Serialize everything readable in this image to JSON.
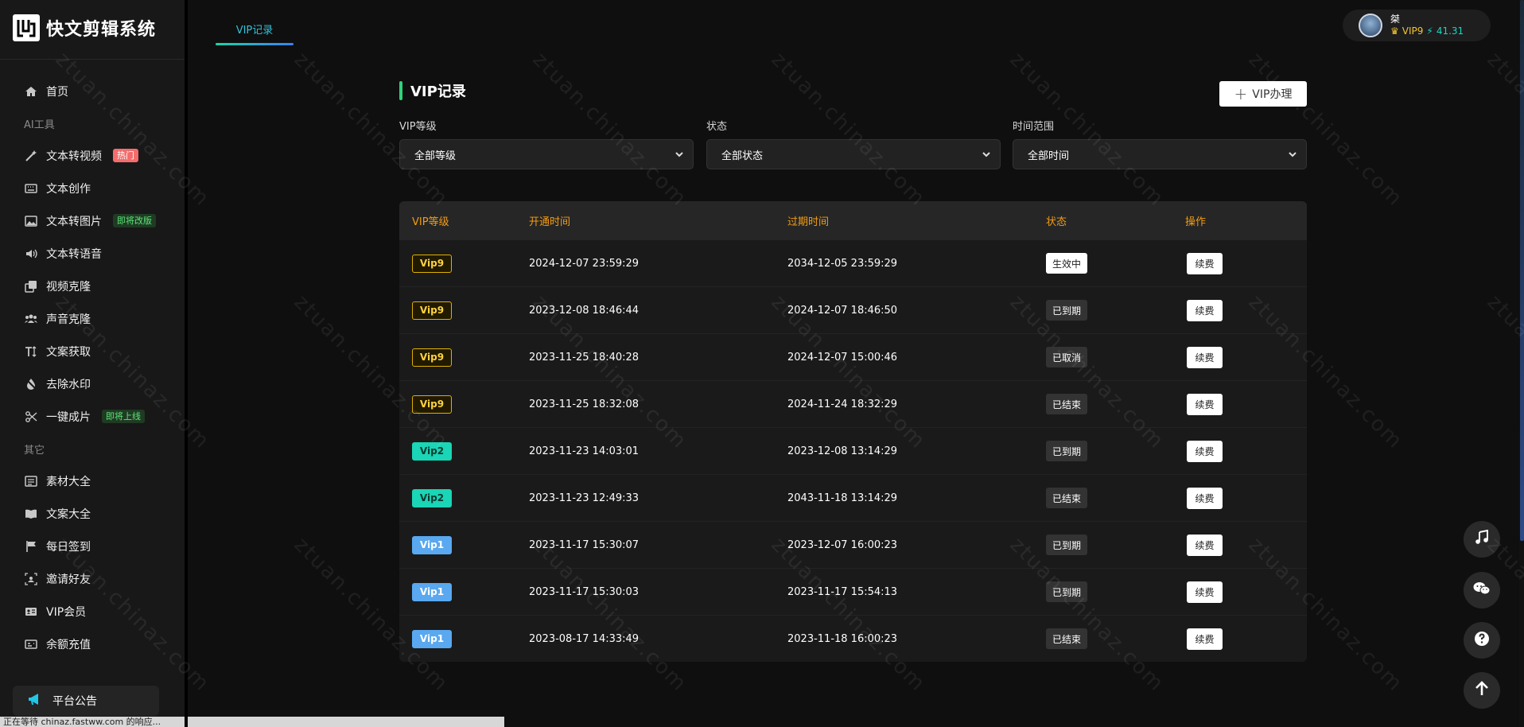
{
  "app": {
    "logo_text": "快文剪辑系统"
  },
  "sidebar": {
    "items": [
      {
        "label": "首页"
      },
      {
        "section": "AI工具"
      },
      {
        "label": "文本转视频",
        "tag": "热门"
      },
      {
        "label": "文本创作"
      },
      {
        "label": "文本转图片",
        "tag": "即将改版"
      },
      {
        "label": "文本转语音"
      },
      {
        "label": "视频克隆"
      },
      {
        "label": "声音克隆"
      },
      {
        "label": "文案获取"
      },
      {
        "label": "去除水印"
      },
      {
        "label": "一键成片",
        "tag": "即将上线"
      },
      {
        "section": "其它"
      },
      {
        "label": "素材大全"
      },
      {
        "label": "文案大全"
      },
      {
        "label": "每日签到"
      },
      {
        "label": "邀请好友"
      },
      {
        "label": "VIP会员"
      },
      {
        "label": "余额充值"
      }
    ],
    "notice_label": "平台公告"
  },
  "status_bar": "正在等待 chinaz.fastww.com 的响应...",
  "topnav": {
    "active_tab": "VIP记录"
  },
  "user": {
    "name": "桀",
    "vip": "VIP9",
    "balance": "41.31"
  },
  "main": {
    "title": "VIP记录",
    "vip_button": "VIP办理",
    "filters": [
      {
        "label": "VIP等级",
        "value": "全部等级"
      },
      {
        "label": "状态",
        "value": "全部状态"
      },
      {
        "label": "时间范围",
        "value": "全部时间"
      }
    ],
    "table": {
      "headers": [
        "VIP等级",
        "开通时间",
        "过期时间",
        "状态",
        "操作"
      ],
      "rows": [
        {
          "level": "Vip9",
          "open": "2024-12-07 23:59:29",
          "expire": "2034-12-05 23:59:29",
          "status": "生效中",
          "action": "续费"
        },
        {
          "level": "Vip9",
          "open": "2023-12-08 18:46:44",
          "expire": "2024-12-07 18:46:50",
          "status": "已到期",
          "action": "续费"
        },
        {
          "level": "Vip9",
          "open": "2023-11-25 18:40:28",
          "expire": "2024-12-07 15:00:46",
          "status": "已取消",
          "action": "续费"
        },
        {
          "level": "Vip9",
          "open": "2023-11-25 18:32:08",
          "expire": "2024-11-24 18:32:29",
          "status": "已结束",
          "action": "续费"
        },
        {
          "level": "Vip2",
          "open": "2023-11-23 14:03:01",
          "expire": "2023-12-08 13:14:29",
          "status": "已到期",
          "action": "续费"
        },
        {
          "level": "Vip2",
          "open": "2023-11-23 12:49:33",
          "expire": "2043-11-18 13:14:29",
          "status": "已结束",
          "action": "续费"
        },
        {
          "level": "Vip1",
          "open": "2023-11-17 15:30:07",
          "expire": "2023-12-07 16:00:23",
          "status": "已到期",
          "action": "续费"
        },
        {
          "level": "Vip1",
          "open": "2023-11-17 15:30:03",
          "expire": "2023-11-17 15:54:13",
          "status": "已到期",
          "action": "续费"
        },
        {
          "level": "Vip1",
          "open": "2023-08-17 14:33:49",
          "expire": "2023-11-18 16:00:23",
          "status": "已结束",
          "action": "续费"
        }
      ]
    }
  },
  "watermark": "ztuan.chinaz.com",
  "colors": {
    "accent_teal": "#18d6c4",
    "header_orange": "#f39c12",
    "vip_gold": "#ffd23f",
    "hot_red": "#f56c6c"
  },
  "float_buttons": [
    "music-icon",
    "wechat-icon",
    "help-icon",
    "back-to-top-icon"
  ]
}
